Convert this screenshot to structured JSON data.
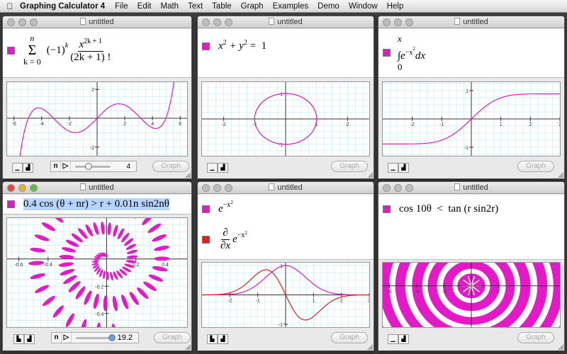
{
  "menubar": {
    "app": "Graphing Calculator 4",
    "items": [
      "File",
      "Edit",
      "Math",
      "Text",
      "Table",
      "Graph",
      "Examples",
      "Demo",
      "Window",
      "Help"
    ]
  },
  "colors": {
    "magenta": "#e619c8",
    "red": "#e52020",
    "grid": "#c8f0f0"
  },
  "windows": [
    {
      "title": "untitled",
      "eq": {
        "sum_top": "n",
        "sum": "Σ",
        "sum_bottom": "k = 0",
        "base": "(−1)",
        "exp_k": "k",
        "num": "x",
        "num_exp": "2k + 1",
        "den": "(2k + 1) !"
      },
      "slider": {
        "var": "n",
        "value": "4",
        "fraction": 0.35
      },
      "graph_button": "Graph",
      "chart_data": {
        "type": "line",
        "xlim": [
          -6.5,
          6.5
        ],
        "ylim": [
          -2.6,
          2.5
        ],
        "xticks": [
          "-6",
          "-4",
          "-2",
          "2",
          "4",
          "6"
        ],
        "xtickv": [
          -6,
          -4,
          -2,
          2,
          4,
          6
        ],
        "yticks": [
          "2",
          "-2"
        ],
        "ytickv": [
          2,
          -2
        ],
        "series": [
          {
            "name": "sin Taylor n=4",
            "color": "#e619c8"
          }
        ]
      }
    },
    {
      "title": "untitled",
      "eq": {
        "text1": "x",
        "e1": "2",
        "plus": " + y",
        "e2": "2",
        "rhs": " =  1"
      },
      "graph_button": "Graph",
      "chart_data": {
        "type": "line",
        "xlim": [
          -2.7,
          2.7
        ],
        "ylim": [
          -1.45,
          1.45
        ],
        "xticks": [
          "-2",
          "-1",
          "1",
          "2"
        ],
        "xtickv": [
          -2,
          -1,
          1,
          2
        ],
        "yticks": [
          "1",
          "-1"
        ],
        "ytickv": [
          1,
          -1
        ],
        "series": [
          {
            "name": "circle",
            "color": "#e619c8"
          }
        ]
      }
    },
    {
      "title": "untitled",
      "eq": {
        "upper": "x",
        "int": "∫",
        "e": "e",
        "exp": "−x",
        "exp2": "2",
        "dx": "dx",
        "lower": "0"
      },
      "graph_button": "Graph",
      "chart_data": {
        "type": "line",
        "xlim": [
          -3,
          3
        ],
        "ylim": [
          -1.3,
          1.3
        ],
        "xticks": [
          "-2",
          "-1",
          "1",
          "2",
          "3"
        ],
        "xtickv": [
          -2,
          -1,
          1,
          2,
          3
        ],
        "yticks": [
          "1",
          "-1"
        ],
        "ytickv": [
          1,
          -1
        ],
        "series": [
          {
            "name": "integral",
            "color": "#e619c8"
          }
        ]
      }
    },
    {
      "title": "untitled",
      "eq": {
        "text": "0.4 cos (θ + nr) > r + 0.01n sin2nθ"
      },
      "slider": {
        "var": "n",
        "value": "19.2",
        "fraction": 0.95
      },
      "graph_button": "Graph",
      "chart_data": {
        "type": "scatter",
        "xlim": [
          -0.68,
          0.55
        ],
        "ylim": [
          -0.5,
          0.3
        ],
        "xticks": [
          "-0.6",
          "-0.4",
          "0.2",
          "0.4"
        ],
        "xtickv": [
          -0.6,
          -0.4,
          0.2,
          0.4
        ],
        "yticks": [
          "-0.2",
          "-0.4"
        ],
        "ytickv": [
          -0.2,
          -0.4
        ],
        "series": [
          {
            "name": "spiral region",
            "color": "#e619c8"
          }
        ]
      }
    },
    {
      "title": "untitled",
      "eq": {
        "e": "e",
        "exp": "−x",
        "exp2": "2",
        "d": "∂",
        "dx": "∂x"
      },
      "graph_button": "Graph",
      "chart_data": {
        "type": "line",
        "xlim": [
          -3,
          3
        ],
        "ylim": [
          -1.1,
          1.1
        ],
        "xticks": [
          "-2",
          "-1",
          "1",
          "2",
          "3"
        ],
        "xtickv": [
          -2,
          -1,
          1,
          2,
          3
        ],
        "yticks": [
          "1",
          "-1"
        ],
        "ytickv": [
          1,
          -1
        ],
        "series": [
          {
            "name": "e^-x^2",
            "color": "#e619c8"
          },
          {
            "name": "derivative",
            "color": "#e52020"
          }
        ]
      }
    },
    {
      "title": "untitled",
      "eq": {
        "text": "cos 10θ  <  tan (r sin2r)"
      },
      "graph_button": "Graph",
      "chart_data": {
        "type": "heatmap",
        "xlim": [
          -6.5,
          6.5
        ],
        "ylim": [
          -3.2,
          1.8
        ],
        "xticks": [
          "-6",
          "-4",
          "-2",
          "2"
        ],
        "xtickv": [
          -6,
          -4,
          -2,
          2
        ],
        "yticks": [],
        "ytickv": [],
        "series": [
          {
            "name": "inequality region",
            "color": "#e619c8"
          }
        ]
      }
    }
  ]
}
